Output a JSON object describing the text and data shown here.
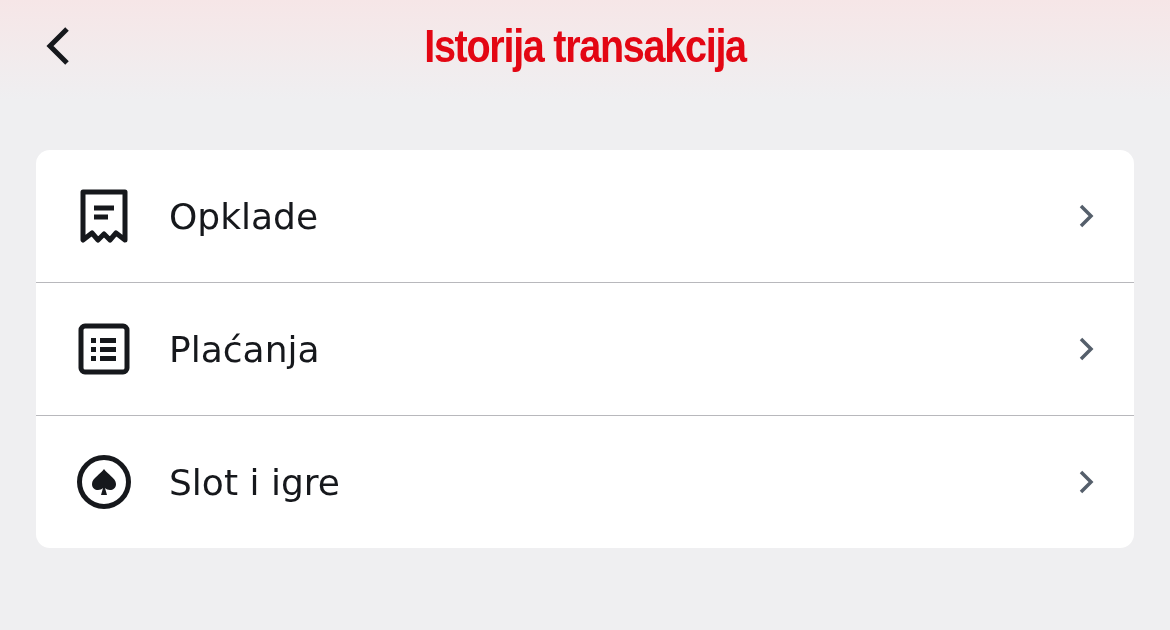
{
  "header": {
    "title": "Istorija transakcija"
  },
  "menu": [
    {
      "kind": "receipt",
      "label": "Opklade"
    },
    {
      "kind": "list",
      "label": "Plaćanja"
    },
    {
      "kind": "spade",
      "label": "Slot i igre"
    }
  ]
}
